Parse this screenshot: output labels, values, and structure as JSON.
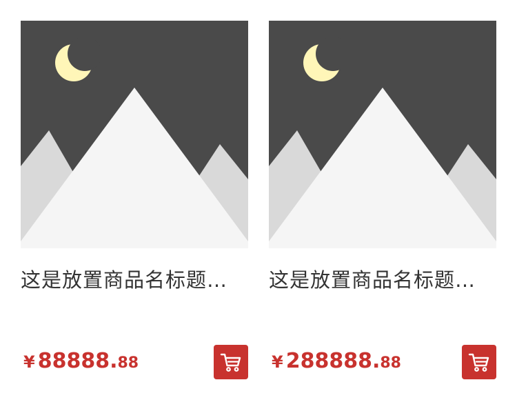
{
  "products": [
    {
      "title": "这是放置商品名标题…",
      "price_symbol": "¥",
      "price_integer": "88888.",
      "price_decimal": "88"
    },
    {
      "title": "这是放置商品名标题…",
      "price_symbol": "¥",
      "price_integer": "288888.",
      "price_decimal": "88"
    }
  ],
  "colors": {
    "accent": "#c8322e",
    "placeholder_sky": "#4a4a4a",
    "placeholder_moon": "#fff6b8",
    "placeholder_mountain_front": "#f5f5f5",
    "placeholder_mountain_back": "#d9d9d9"
  },
  "icons": {
    "thumbnail": "image-placeholder-icon",
    "cart": "shopping-cart-icon"
  }
}
